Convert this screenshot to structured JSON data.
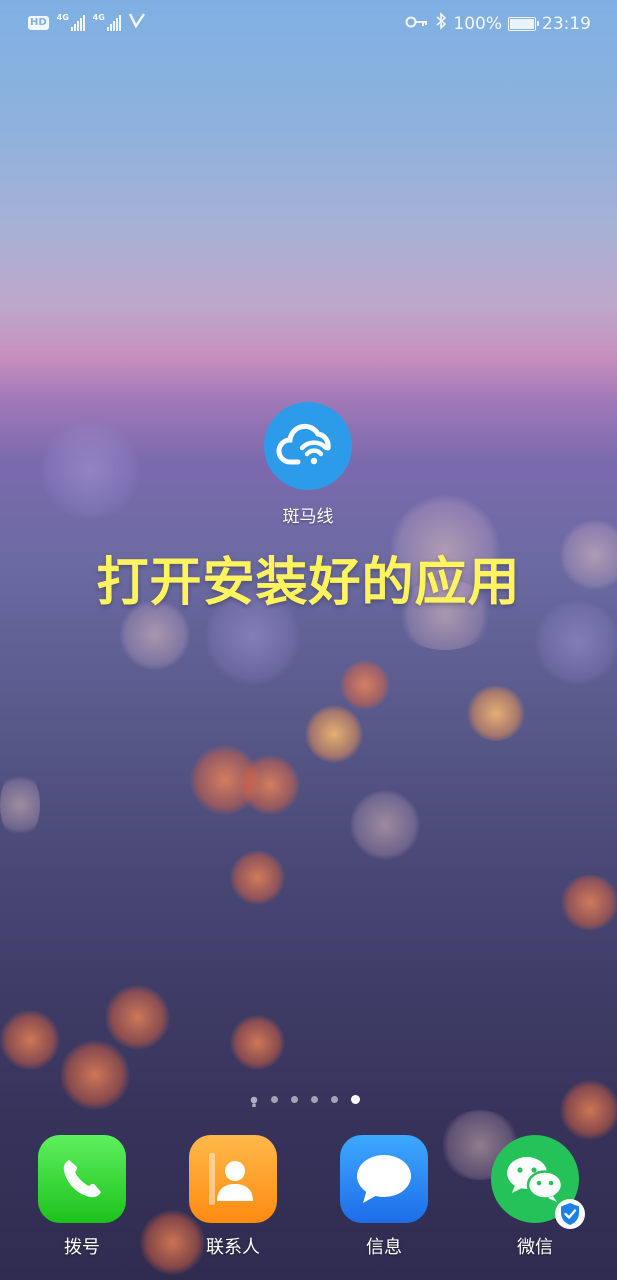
{
  "status_bar": {
    "left_badge": "HD",
    "network_1": "4G",
    "network_2": "4G",
    "battery_percent": "100%",
    "time": "23:19",
    "icons": [
      "hd-icon",
      "signal-icon",
      "signal-icon",
      "volte-icon",
      "key-icon",
      "bluetooth-icon",
      "battery-icon"
    ]
  },
  "home": {
    "app_icon": "cloud-wifi-icon",
    "app_label": "斑马线",
    "caption": "打开安装好的应用",
    "caption_color": "#fff45e"
  },
  "page_indicator": {
    "total_pages": 6,
    "current_page": 6
  },
  "dock": {
    "apps": [
      {
        "label": "拨号",
        "icon": "phone-icon",
        "color": "#2fd62f"
      },
      {
        "label": "联系人",
        "icon": "contacts-icon",
        "color": "#ff9f2a"
      },
      {
        "label": "信息",
        "icon": "message-icon",
        "color": "#2b8cf5"
      },
      {
        "label": "微信",
        "icon": "wechat-icon",
        "color": "#25c25a"
      }
    ]
  }
}
